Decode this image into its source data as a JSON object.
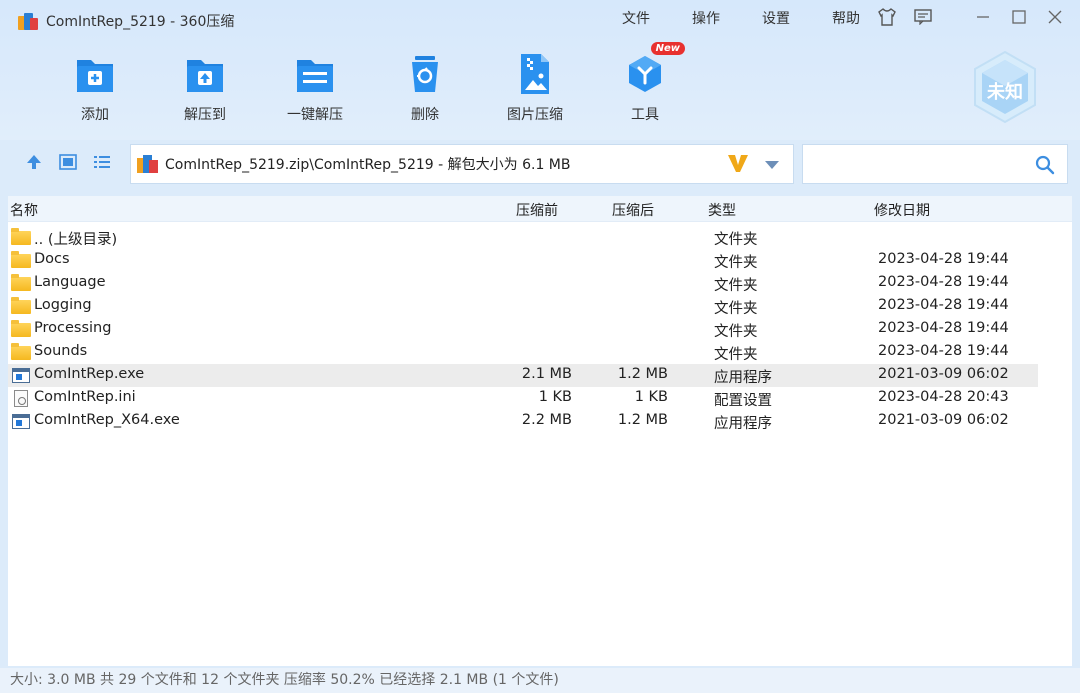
{
  "window": {
    "title": "ComIntRep_5219 - 360压缩"
  },
  "menu": {
    "items": [
      "文件",
      "操作",
      "设置",
      "帮助"
    ]
  },
  "toolbar": {
    "buttons": [
      {
        "label": "添加",
        "icon": "add-icon"
      },
      {
        "label": "解压到",
        "icon": "extract-to-icon"
      },
      {
        "label": "一键解压",
        "icon": "one-click-extract-icon"
      },
      {
        "label": "删除",
        "icon": "delete-icon"
      },
      {
        "label": "图片压缩",
        "icon": "image-compress-icon"
      },
      {
        "label": "工具",
        "icon": "tools-icon"
      }
    ],
    "new_badge": "New",
    "unknown_badge": "未知"
  },
  "address": {
    "path": "ComIntRep_5219.zip\\ComIntRep_5219 - 解包大小为 6.1 MB",
    "search_placeholder": ""
  },
  "columns": {
    "name": "名称",
    "before": "压缩前",
    "after": "压缩后",
    "type": "类型",
    "date": "修改日期"
  },
  "files": [
    {
      "name": ".. (上级目录)",
      "kind": "folder",
      "before": "",
      "after": "",
      "type": "文件夹",
      "date": ""
    },
    {
      "name": "Docs",
      "kind": "folder",
      "before": "",
      "after": "",
      "type": "文件夹",
      "date": "2023-04-28 19:44"
    },
    {
      "name": "Language",
      "kind": "folder",
      "before": "",
      "after": "",
      "type": "文件夹",
      "date": "2023-04-28 19:44"
    },
    {
      "name": "Logging",
      "kind": "folder",
      "before": "",
      "after": "",
      "type": "文件夹",
      "date": "2023-04-28 19:44"
    },
    {
      "name": "Processing",
      "kind": "folder",
      "before": "",
      "after": "",
      "type": "文件夹",
      "date": "2023-04-28 19:44"
    },
    {
      "name": "Sounds",
      "kind": "folder",
      "before": "",
      "after": "",
      "type": "文件夹",
      "date": "2023-04-28 19:44"
    },
    {
      "name": "ComIntRep.exe",
      "kind": "exe",
      "before": "2.1 MB",
      "after": "1.2 MB",
      "type": "应用程序",
      "date": "2021-03-09 06:02",
      "selected": true
    },
    {
      "name": "ComIntRep.ini",
      "kind": "ini",
      "before": "1 KB",
      "after": "1 KB",
      "type": "配置设置",
      "date": "2023-04-28 20:43"
    },
    {
      "name": "ComIntRep_X64.exe",
      "kind": "exe",
      "before": "2.2 MB",
      "after": "1.2 MB",
      "type": "应用程序",
      "date": "2021-03-09 06:02"
    }
  ],
  "status": {
    "text": "大小: 3.0 MB 共 29 个文件和 12 个文件夹 压缩率 50.2% 已经选择 2.1 MB (1 个文件)"
  }
}
